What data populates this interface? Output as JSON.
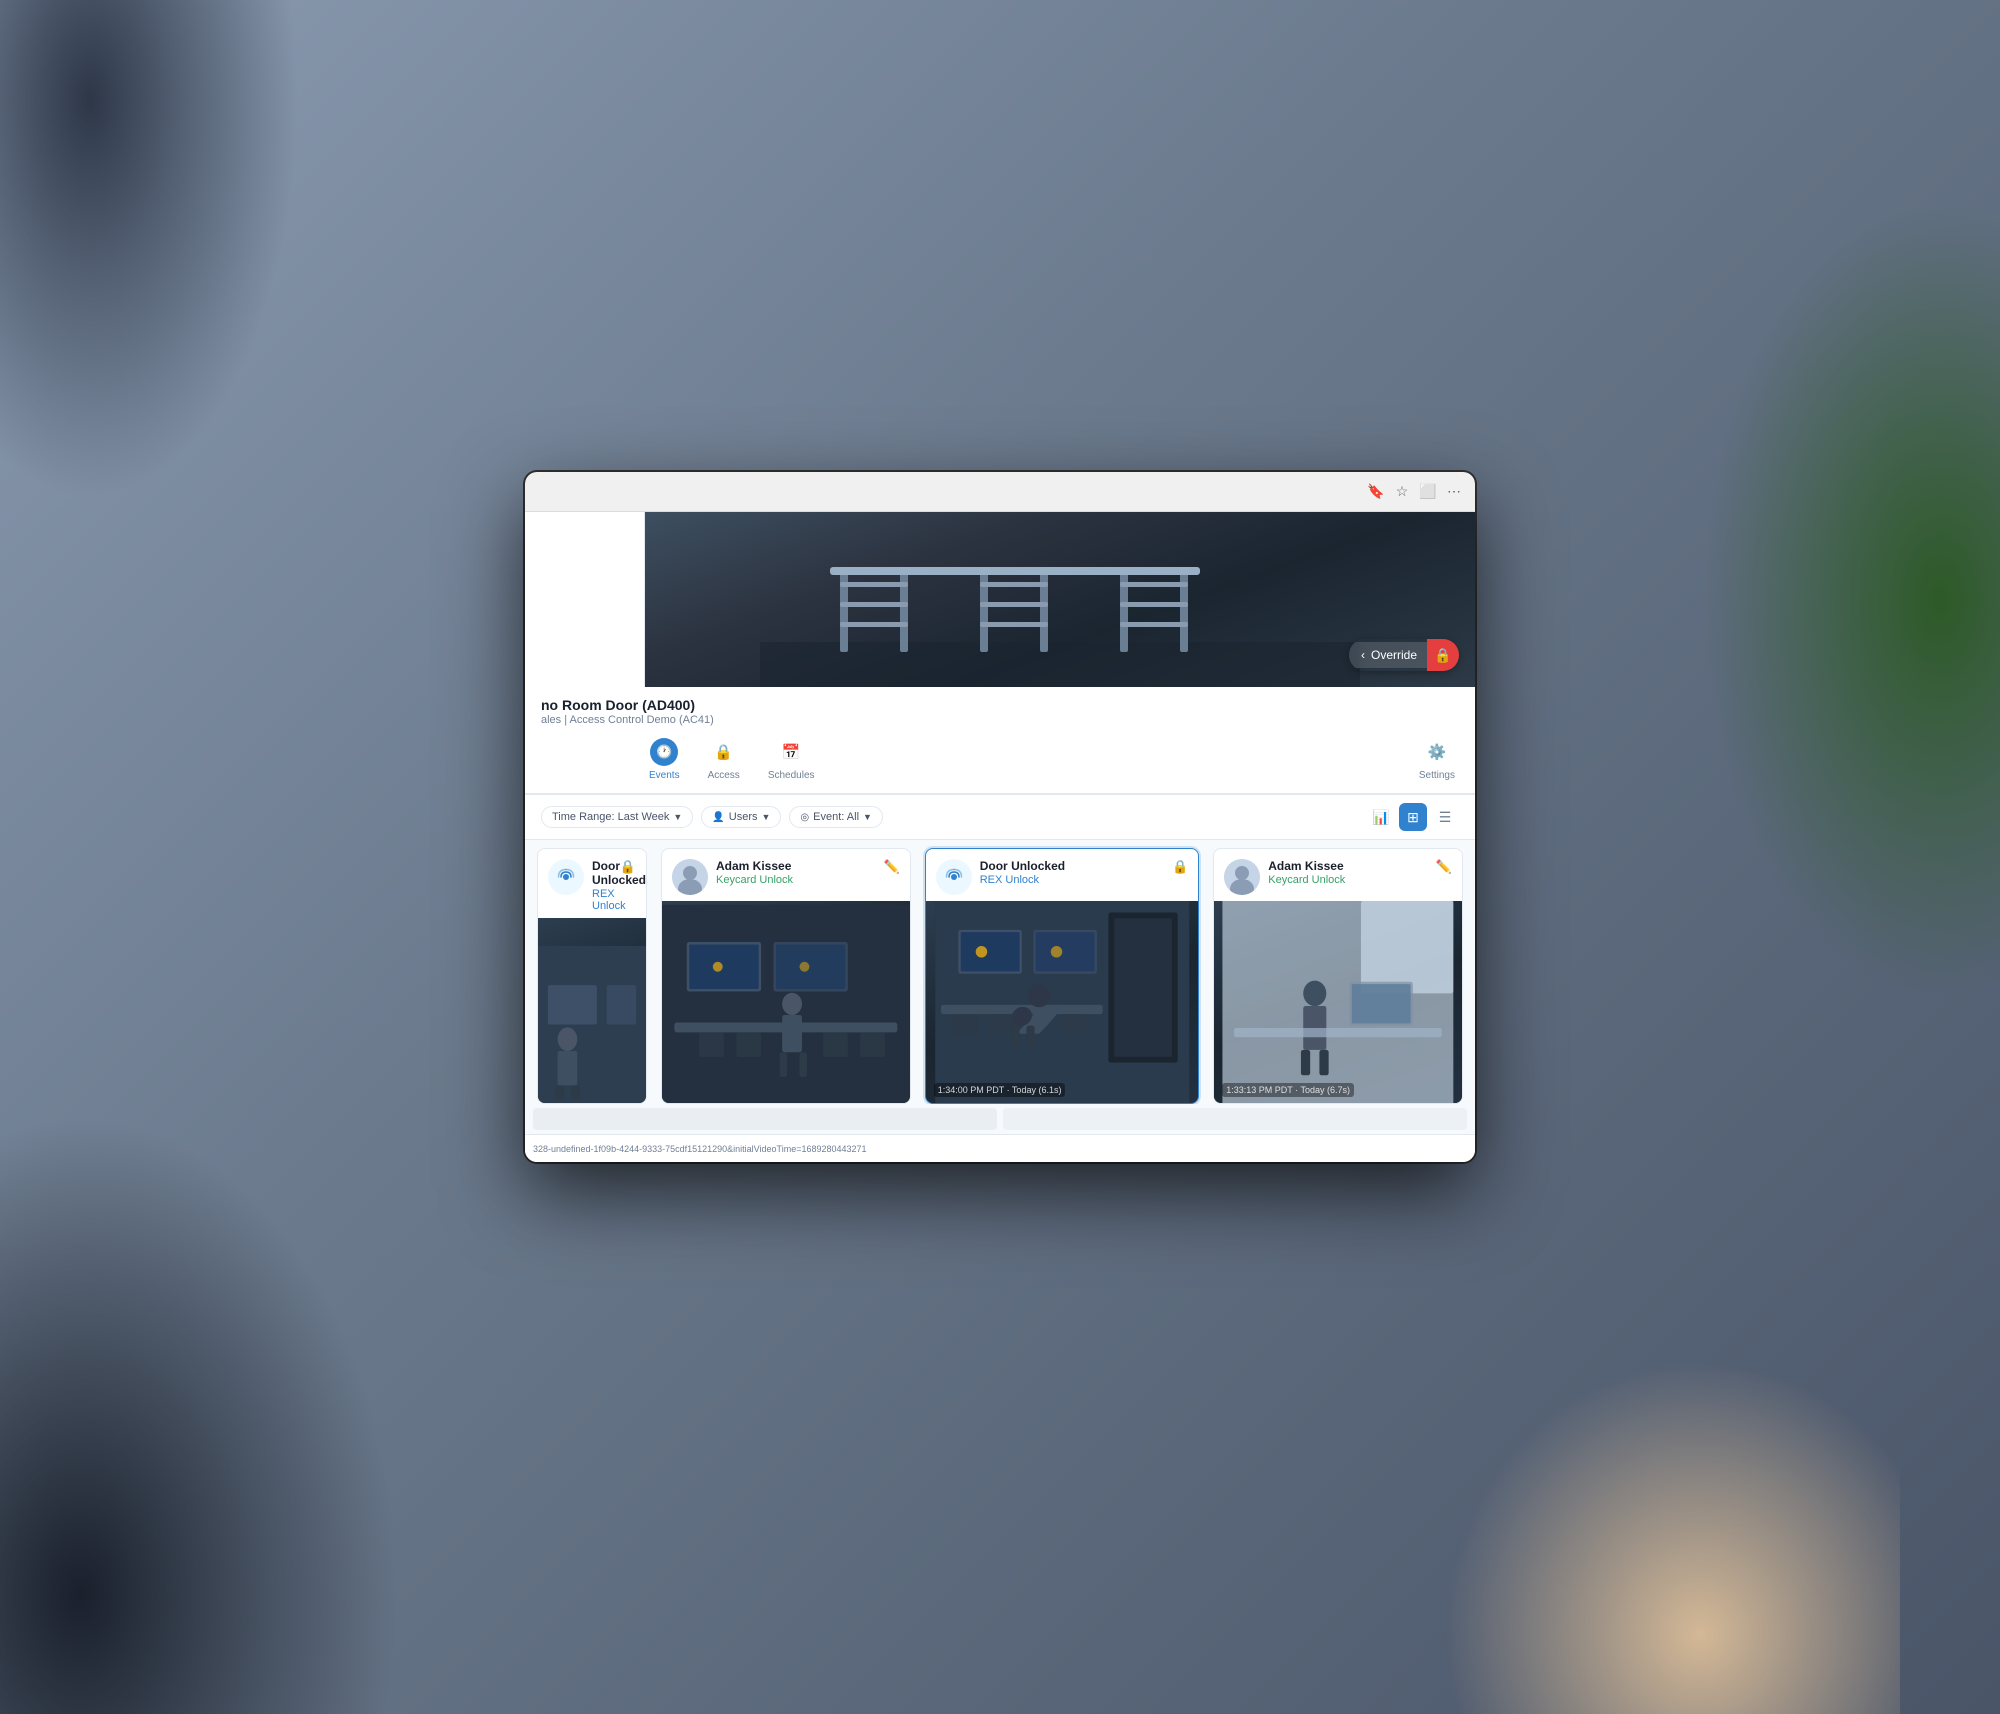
{
  "environment": {
    "background_color": "#6b7a8d"
  },
  "browser": {
    "icons": [
      "bookmark",
      "star",
      "fullscreen",
      "menu"
    ]
  },
  "door": {
    "name": "no Room Door (AD400)",
    "subtitle": "ales | Access Control Demo (AC41)"
  },
  "nav": {
    "tabs": [
      {
        "id": "events",
        "label": "Events",
        "icon": "🕐",
        "active": true
      },
      {
        "id": "access",
        "label": "Access",
        "icon": "🔒",
        "active": false
      },
      {
        "id": "schedules",
        "label": "Schedules",
        "icon": "📅",
        "active": false
      }
    ],
    "settings_label": "Settings"
  },
  "filters": {
    "time_range_label": "Time Range: Last Week",
    "users_label": "Users",
    "event_label": "Event: All"
  },
  "view_toggle": {
    "options": [
      "bar-chart",
      "grid",
      "list"
    ]
  },
  "override_button": {
    "back_icon": "‹",
    "label": "Override",
    "lock_icon": "🔒"
  },
  "events": [
    {
      "id": "card-1",
      "type": "Door Unlocked",
      "subtype": "REX Unlock",
      "subtype_color": "blue",
      "avatar_type": "radio",
      "partial": true,
      "timestamp": null
    },
    {
      "id": "card-2",
      "type": "Adam Kissee",
      "subtype": "Keycard Unlock",
      "subtype_color": "green",
      "avatar_type": "person",
      "partial": false,
      "timestamp": null
    },
    {
      "id": "card-3",
      "type": "Door Unlocked",
      "subtype": "REX Unlock",
      "subtype_color": "blue",
      "avatar_type": "radio",
      "partial": false,
      "highlighted": true,
      "timestamp": "1:34:00 PM PDT · Today (6.1s)"
    },
    {
      "id": "card-4",
      "type": "Adam Kissee",
      "subtype": "Keycard Unlock",
      "subtype_color": "green",
      "avatar_type": "person",
      "partial": false,
      "timestamp": "1:33:13 PM PDT · Today (6.7s)"
    }
  ],
  "bottom_url": "328-undefined-1f09b-4244-9333-75cdf15121290&initialVideoTime=1689280443271"
}
